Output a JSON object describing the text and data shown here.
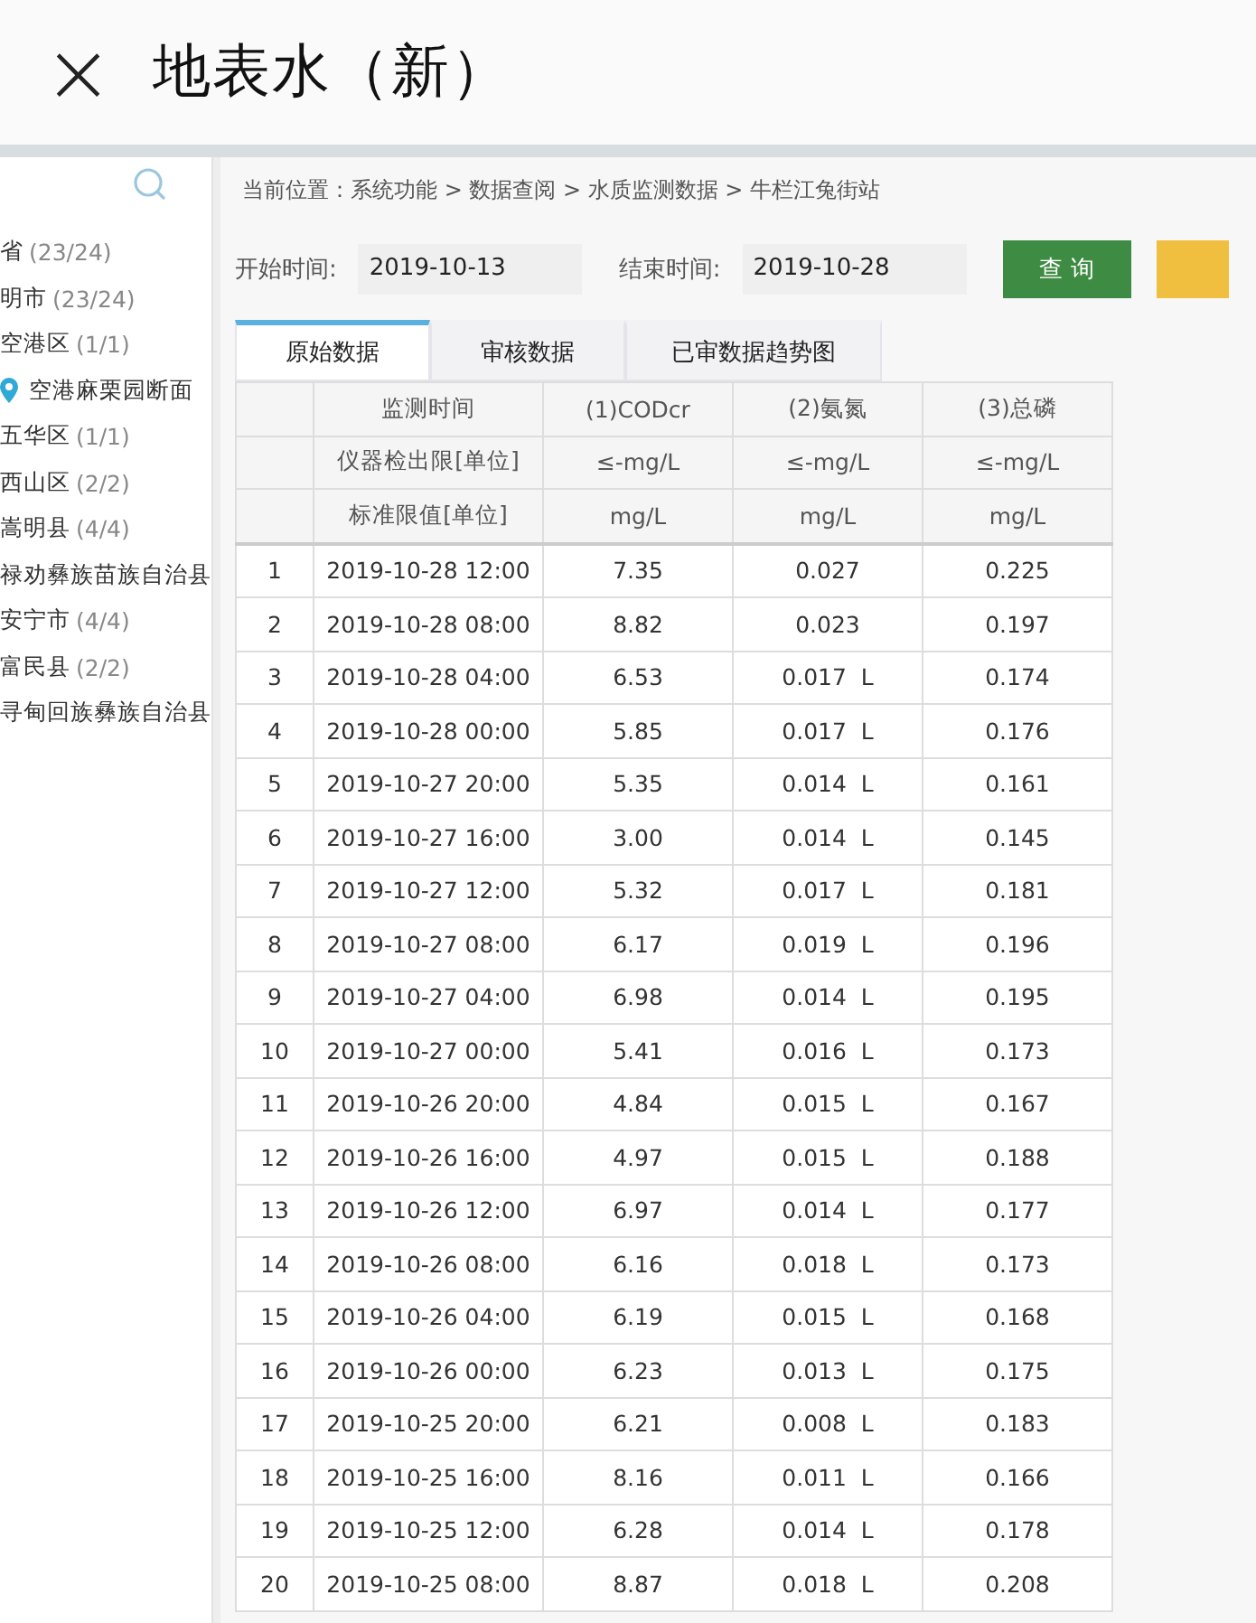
{
  "header": {
    "close_icon": "×",
    "title": "地表水（新）"
  },
  "sidebar": {
    "tree": [
      {
        "name": "省",
        "count": "(23/24)",
        "kind": "folder",
        "children": [
          {
            "name": "明市",
            "count": "(23/24)",
            "kind": "folder",
            "children": [
              {
                "name": "空港区",
                "count": "(1/1)",
                "kind": "folder",
                "children": [
                  {
                    "name": "空港麻栗园断面",
                    "kind": "station"
                  }
                ]
              },
              {
                "name": "五华区",
                "count": "(1/1)",
                "kind": "folder"
              },
              {
                "name": "西山区",
                "count": "(2/2)",
                "kind": "folder"
              },
              {
                "name": "嵩明县",
                "count": "(4/4)",
                "kind": "folder"
              },
              {
                "name": "禄劝彝族苗族自治县",
                "kind": "folder"
              },
              {
                "name": "安宁市",
                "count": "(4/4)",
                "kind": "folder"
              },
              {
                "name": "富民县",
                "count": "(2/2)",
                "kind": "folder"
              },
              {
                "name": "寻甸回族彝族自治县",
                "kind": "folder"
              }
            ]
          }
        ]
      }
    ]
  },
  "breadcrumb": "当前位置：系统功能 > 数据查阅 > 水质监测数据 > 牛栏江兔街站",
  "query": {
    "start_label": "开始时间:",
    "start_value": "2019-10-13",
    "end_label": "结束时间:",
    "end_value": "2019-10-28",
    "buttons": [
      {
        "label": "查 询",
        "kind": "primary"
      },
      {
        "kind": "warning"
      }
    ]
  },
  "tabs": [
    {
      "label": "原始数据",
      "selected": true
    },
    {
      "label": "审核数据",
      "selected": false
    },
    {
      "label": "已审数据趋势图",
      "selected": false
    }
  ],
  "table": {
    "columns": [
      "监测时间",
      "(1)CODcr",
      "(2)氨氮",
      "(3)总磷"
    ],
    "detection_limit": [
      "仪器检出限[单位]",
      "≤-mg/L",
      "≤-mg/L",
      "≤-mg/L"
    ],
    "standard_limit": [
      "标准限值[单位]",
      "mg/L",
      "mg/L",
      "mg/L"
    ],
    "rows": [
      {
        "index": "1",
        "time": "2019-10-28 12:00",
        "cod": "7.35",
        "nh3": "0.027",
        "tp": "0.225"
      },
      {
        "index": "2",
        "time": "2019-10-28 08:00",
        "cod": "8.82",
        "nh3": "0.023",
        "tp": "0.197"
      },
      {
        "index": "3",
        "time": "2019-10-28 04:00",
        "cod": "6.53",
        "nh3": "0.017",
        "flag": "L",
        "tp": "0.174"
      },
      {
        "index": "4",
        "time": "2019-10-28 00:00",
        "cod": "5.85",
        "nh3": "0.017",
        "flag": "L",
        "tp": "0.176"
      },
      {
        "index": "5",
        "time": "2019-10-27 20:00",
        "cod": "5.35",
        "nh3": "0.014",
        "flag": "L",
        "tp": "0.161"
      },
      {
        "index": "6",
        "time": "2019-10-27 16:00",
        "cod": "3.00",
        "nh3": "0.014",
        "flag": "L",
        "tp": "0.145"
      },
      {
        "index": "7",
        "time": "2019-10-27 12:00",
        "cod": "5.32",
        "nh3": "0.017",
        "flag": "L",
        "tp": "0.181"
      },
      {
        "index": "8",
        "time": "2019-10-27 08:00",
        "cod": "6.17",
        "nh3": "0.019",
        "flag": "L",
        "tp": "0.196"
      },
      {
        "index": "9",
        "time": "2019-10-27 04:00",
        "cod": "6.98",
        "nh3": "0.014",
        "flag": "L",
        "tp": "0.195"
      },
      {
        "index": "10",
        "time": "2019-10-27 00:00",
        "cod": "5.41",
        "nh3": "0.016",
        "flag": "L",
        "tp": "0.173"
      },
      {
        "index": "11",
        "time": "2019-10-26 20:00",
        "cod": "4.84",
        "nh3": "0.015",
        "flag": "L",
        "tp": "0.167"
      },
      {
        "index": "12",
        "time": "2019-10-26 16:00",
        "cod": "4.97",
        "nh3": "0.015",
        "flag": "L",
        "tp": "0.188"
      },
      {
        "index": "13",
        "time": "2019-10-26 12:00",
        "cod": "6.97",
        "nh3": "0.014",
        "flag": "L",
        "tp": "0.177"
      },
      {
        "index": "14",
        "time": "2019-10-26 08:00",
        "cod": "6.16",
        "nh3": "0.018",
        "flag": "L",
        "tp": "0.173"
      },
      {
        "index": "15",
        "time": "2019-10-26 04:00",
        "cod": "6.19",
        "nh3": "0.015",
        "flag": "L",
        "tp": "0.168"
      },
      {
        "index": "16",
        "time": "2019-10-26 00:00",
        "cod": "6.23",
        "nh3": "0.013",
        "flag": "L",
        "tp": "0.175"
      },
      {
        "index": "17",
        "time": "2019-10-25 20:00",
        "cod": "6.21",
        "nh3": "0.008",
        "flag": "L",
        "tp": "0.183"
      },
      {
        "index": "18",
        "time": "2019-10-25 16:00",
        "cod": "8.16",
        "nh3": "0.011",
        "flag": "L",
        "tp": "0.166"
      },
      {
        "index": "19",
        "time": "2019-10-25 12:00",
        "cod": "6.28",
        "nh3": "0.014",
        "flag": "L",
        "tp": "0.178"
      },
      {
        "index": "20",
        "time": "2019-10-25 08:00",
        "cod": "8.87",
        "nh3": "0.018",
        "flag": "L",
        "tp": "0.208"
      }
    ]
  }
}
